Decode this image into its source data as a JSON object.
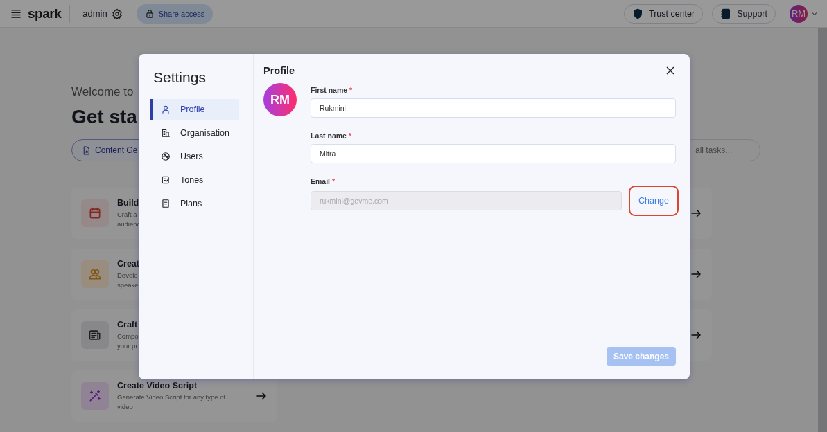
{
  "topbar": {
    "brand": "spark",
    "workspace": "admin",
    "share_button": "Share access",
    "trust_button": "Trust center",
    "support_button": "Support",
    "avatar": "RM"
  },
  "background": {
    "welcome": "Welcome to",
    "heading": "Get sta",
    "filter_chip": "Content Ge",
    "search_placeholder": "all tasks...",
    "cards": [
      {
        "kind": "calendar",
        "title": "Build",
        "desc_lines": [
          "Craft a",
          "audienc"
        ]
      },
      {
        "kind": "people",
        "title": "Creat",
        "desc_lines": [
          "Develo",
          "speake"
        ]
      },
      {
        "kind": "news",
        "title": "Craft",
        "desc_lines": [
          "Compo",
          "your pr"
        ]
      },
      {
        "kind": "wand",
        "title": "Create Video Script",
        "desc_lines": [
          "Generate Video Script for any type of",
          "video"
        ]
      }
    ]
  },
  "modal": {
    "title": "Settings",
    "nav": [
      {
        "kind": "person",
        "label": "Profile",
        "selected": true
      },
      {
        "kind": "building",
        "label": "Organisation",
        "selected": false
      },
      {
        "kind": "globe",
        "label": "Users",
        "selected": false
      },
      {
        "kind": "note",
        "label": "Tones",
        "selected": false
      },
      {
        "kind": "doc",
        "label": "Plans",
        "selected": false
      }
    ],
    "section_title": "Profile",
    "avatar": "RM",
    "fields": [
      {
        "label": "First name",
        "required_mark": "*",
        "value": "Rukmini",
        "disabled": false
      },
      {
        "label": "Last name",
        "required_mark": "*",
        "value": "Mitra",
        "disabled": false
      },
      {
        "label": "Email",
        "required_mark": "*",
        "value": "rukmini@gevme.com",
        "disabled": true
      }
    ],
    "change_button": "Change",
    "save_button": {
      "label": "Save changes",
      "disabled": true
    }
  }
}
